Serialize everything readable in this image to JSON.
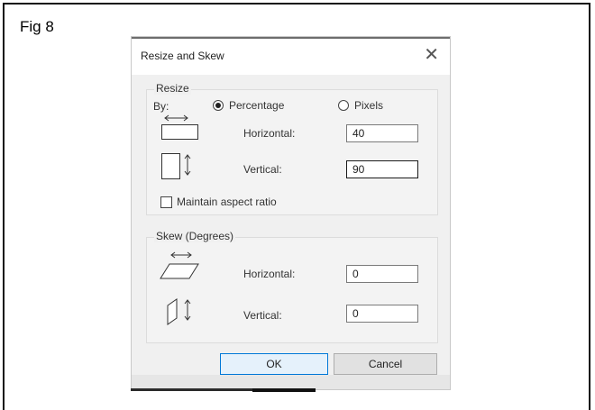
{
  "figure_label": "Fig 8",
  "dialog": {
    "title": "Resize and Skew",
    "close_symbol": "✕"
  },
  "resize": {
    "group_title": "Resize",
    "by_label": "By:",
    "option_percentage": "Percentage",
    "option_pixels": "Pixels",
    "selected_option": "Percentage",
    "horizontal_label": "Horizontal:",
    "horizontal_value": "40",
    "vertical_label": "Vertical:",
    "vertical_value": "90",
    "maintain_aspect_label": "Maintain aspect ratio",
    "maintain_aspect_checked": false,
    "horizontal_icon": "resize-horizontal-icon",
    "vertical_icon": "resize-vertical-icon"
  },
  "skew": {
    "group_title": "Skew (Degrees)",
    "horizontal_label": "Horizontal:",
    "horizontal_value": "0",
    "vertical_label": "Vertical:",
    "vertical_value": "0",
    "horizontal_icon": "skew-horizontal-icon",
    "vertical_icon": "skew-vertical-icon"
  },
  "buttons": {
    "ok_label": "OK",
    "cancel_label": "Cancel"
  }
}
